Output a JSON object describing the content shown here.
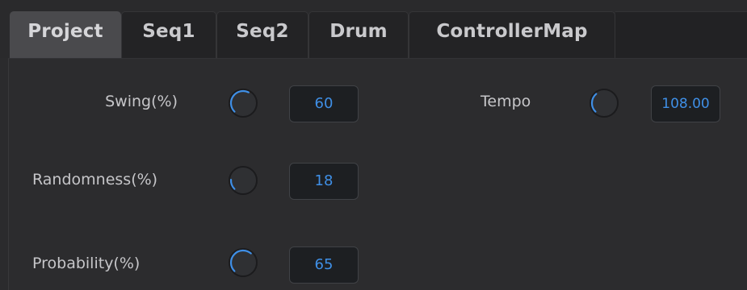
{
  "tabs": [
    {
      "label": "Project",
      "active": true
    },
    {
      "label": "Seq1",
      "active": false
    },
    {
      "label": "Seq2",
      "active": false
    },
    {
      "label": "Drum",
      "active": false
    },
    {
      "label": "ControllerMap",
      "active": false
    }
  ],
  "params": {
    "swing": {
      "label": "Swing(%)",
      "value": "60",
      "knob_fraction": 0.6
    },
    "randomness": {
      "label": "Randomness(%)",
      "value": "18",
      "knob_fraction": 0.18
    },
    "probability": {
      "label": "Probability(%)",
      "value": "65",
      "knob_fraction": 0.65
    },
    "tempo": {
      "label": "Tempo",
      "value": "108.00",
      "knob_fraction": 0.35
    }
  },
  "colors": {
    "accent": "#3f8fe6",
    "background": "#2b2b2d",
    "active_tab": "#4a4a4d",
    "value_box": "#1d1f22"
  }
}
